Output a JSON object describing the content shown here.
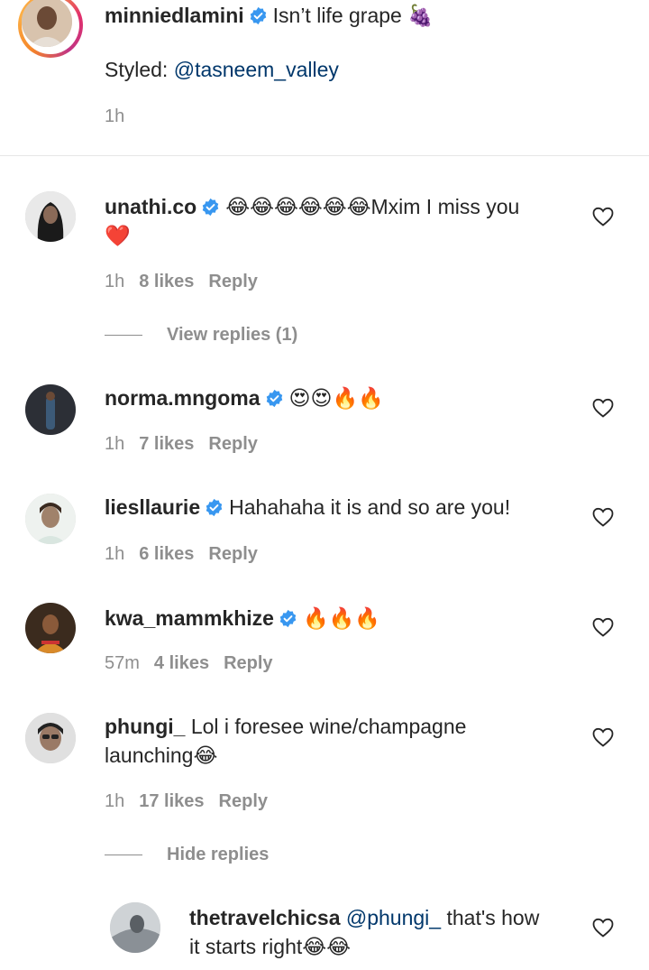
{
  "caption": {
    "username": "minniedlamini",
    "text": "Isn’t life grape",
    "text_emoji": "🍇",
    "styled_label": "Styled:",
    "styled_mention": "@tasneem_valley",
    "time": "1h"
  },
  "comments": [
    {
      "username": "unathi.co",
      "verified": true,
      "text_emoji": "😂😂😂😂😂😂",
      "text": "Mxim I miss you",
      "text_line2_emoji": "❤️",
      "time": "1h",
      "likes": "8 likes",
      "reply": "Reply",
      "view_replies": "View replies (1)"
    },
    {
      "username": "norma.mngoma",
      "verified": true,
      "text_emoji": "😍😍🔥🔥",
      "time": "1h",
      "likes": "7 likes",
      "reply": "Reply"
    },
    {
      "username": "liesllaurie",
      "verified": true,
      "text": "Hahahaha it is and so are you!",
      "time": "1h",
      "likes": "6 likes",
      "reply": "Reply"
    },
    {
      "username": "kwa_mammkhize",
      "verified": true,
      "text_emoji": "🔥🔥🔥",
      "time": "57m",
      "likes": "4 likes",
      "reply": "Reply"
    },
    {
      "username": "phungi_",
      "verified": false,
      "text": "Lol i foresee wine/champagne",
      "text_line2": "launching",
      "text_line2_emoji": "😂",
      "time": "1h",
      "likes": "17 likes",
      "reply": "Reply",
      "hide_replies": "Hide replies"
    }
  ],
  "reply": {
    "username": "thetravelchicsa",
    "mention": "@phungi_",
    "text": "that's how",
    "text_line2": "it starts right",
    "text_line2_emoji": "😂😂"
  },
  "colors": {
    "verified_blue": "#3897f0",
    "meta_gray": "#8e8e8e",
    "mention_blue": "#00376b"
  }
}
